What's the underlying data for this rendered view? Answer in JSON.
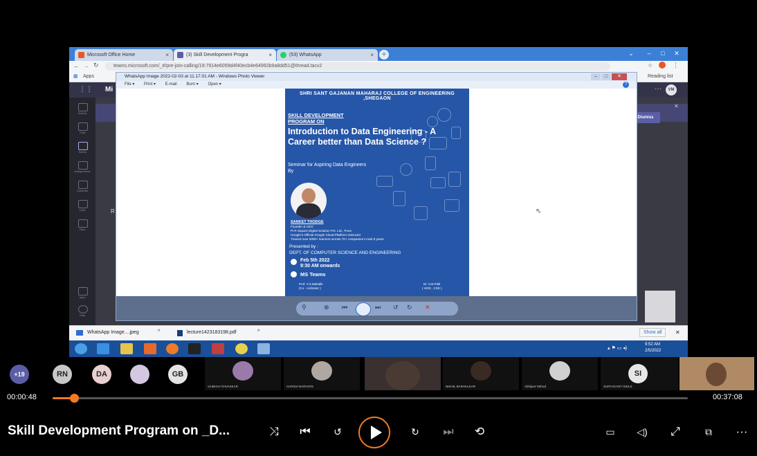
{
  "browser": {
    "tabs": [
      {
        "label": "Microsoft Office Home",
        "color": "#e8562a"
      },
      {
        "label": "(3) Skill Development Progra",
        "color": "#5b5ea6"
      },
      {
        "label": "(53) WhatsApp",
        "color": "#25d366"
      }
    ],
    "url": "teams.microsoft.com/_#/pre-join-calling/19:7914e6059d4f40ecb4e64992b9a8dd51@thread.tacv2",
    "bookmarks": {
      "apps": "Apps",
      "reading_list": "Reading list"
    }
  },
  "teams": {
    "app_initial": "Mi",
    "avatar": "VM",
    "dismiss_label": "Dismiss",
    "rail": [
      "Activity",
      "Chat",
      "Teams",
      "Assignments",
      "Calendar",
      "Calls",
      "Files",
      "Apps",
      "Help"
    ],
    "side_letter": "R"
  },
  "viewer": {
    "title": "WhatsApp Image 2022-02-03 at 11.17.01 AM - Windows Photo Viewer",
    "menu": [
      "File ▾",
      "Print ▾",
      "E-mail",
      "Burn ▾",
      "Open ▾"
    ]
  },
  "poster": {
    "college": "SHRI SANT GAJANAN MAHARAJ COLLEGE OF ENGINEERING ,SHEGAON",
    "program": "SKILL DEVELOPMENT PROGRAM ON",
    "headline": "Introduction to Data Engineering - A Career better than Data Science ?",
    "seminar": "Seminar for Aspiring Data Engineers By",
    "speaker": "SANKET THODGE",
    "speaker_lines": [
      "Founder & CEO",
      "Pi R Square Digital Solution Pvt. Ltd., Pune",
      "Google's Official Google Cloud Platform Instructor",
      "Trained over 5000+ learners across 70+ companies in last 8 years"
    ],
    "presented_by": "Presented by :",
    "dept": "DEPT. OF COMPUTER SCIENCE AND ENGINEERING",
    "date": "Feb 5th 2022",
    "time": "9:30 AM onwards",
    "venue": "MS Teams",
    "coordinator_left": "Prof. V.S.Mahalle",
    "coordinator_left_role": "(Co - ordinator )",
    "coordinator_right": "Dr. S.B.Patil",
    "coordinator_right_role": "( HOD , CSE )"
  },
  "downloads": {
    "items": [
      "WhatsApp Image....jpeg",
      "lecture1423183198.pdf"
    ],
    "show_all": "Show all"
  },
  "taskbar": {
    "time": "9:52 AM",
    "date": "2/5/2022"
  },
  "participants": {
    "overflow": "+19",
    "initials": [
      {
        "label": "RN",
        "color": "#c8c8c8"
      },
      {
        "label": "DA",
        "color": "#e8d0d0"
      },
      {
        "label": "GB",
        "color": "#e4e4e4"
      },
      {
        "label": "SI",
        "color": "#e6e6e6"
      }
    ],
    "names": [
      "VAIBHAV RAVASKAR",
      "HARISH BARHATE",
      "NIKHIL BARHULKAR",
      "Abhijeet Tathod",
      "SURYAKANT INGLE"
    ]
  },
  "player": {
    "elapsed": "00:00:48",
    "total": "00:37:08",
    "progress": 0.034,
    "title": "Skill Development Program on _D...",
    "accent": "#f27a20",
    "icons": [
      "shuffle-icon",
      "previous-icon",
      "rewind-10-icon",
      "play-icon",
      "forward-30-icon",
      "next-icon",
      "repeat-off-icon",
      "captions-icon",
      "volume-icon",
      "fullscreen-icon",
      "mini-player-icon",
      "more-icon"
    ]
  }
}
